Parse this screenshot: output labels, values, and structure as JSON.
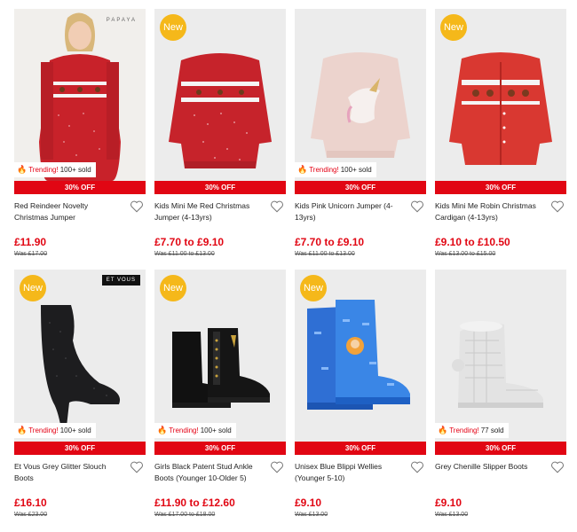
{
  "colors": {
    "accent_red": "#e10613",
    "new_badge": "#f5b81a",
    "card_bg": "#ececec"
  },
  "products": [
    {
      "name": "Red Reindeer Novelty Christmas Jumper",
      "discount": "30% OFF",
      "price": "£11.90",
      "was": "Was £17.00",
      "trending": {
        "label": "Trending!",
        "sold": "100+ sold"
      },
      "brand": "PAPAYA",
      "is_new": false
    },
    {
      "name": "Kids Mini Me Red Christmas Jumper (4-13yrs)",
      "discount": "30% OFF",
      "price": "£7.70 to £9.10",
      "was": "Was £11.00 to £13.00",
      "new_label": "New",
      "is_new": true
    },
    {
      "name": "Kids Pink Unicorn Jumper (4-13yrs)",
      "discount": "30% OFF",
      "price": "£7.70 to £9.10",
      "was": "Was £11.00 to £13.00",
      "trending": {
        "label": "Trending!",
        "sold": "100+ sold"
      },
      "is_new": false
    },
    {
      "name": "Kids Mini Me Robin Christmas Cardigan (4-13yrs)",
      "discount": "30% OFF",
      "price": "£9.10 to £10.50",
      "was": "Was £13.00 to £15.00",
      "new_label": "New",
      "is_new": true
    },
    {
      "name": "Et Vous Grey Glitter Slouch Boots",
      "discount": "30% OFF",
      "price": "£16.10",
      "was": "Was £23.00",
      "trending": {
        "label": "Trending!",
        "sold": "100+ sold"
      },
      "brand": "ET VOUS",
      "new_label": "New",
      "is_new": true
    },
    {
      "name": "Girls Black Patent Stud Ankle Boots (Younger 10-Older 5)",
      "discount": "30% OFF",
      "price": "£11.90 to £12.60",
      "was": "Was £17.00 to £18.00",
      "trending": {
        "label": "Trending!",
        "sold": "100+ sold"
      },
      "new_label": "New",
      "is_new": true
    },
    {
      "name": "Unisex Blue Blippi Wellies (Younger 5-10)",
      "discount": "30% OFF",
      "price": "£9.10",
      "was": "Was £13.00",
      "new_label": "New",
      "is_new": true
    },
    {
      "name": "Grey Chenille Slipper Boots",
      "discount": "30% OFF",
      "price": "£9.10",
      "was": "Was £13.00",
      "trending": {
        "label": "Trending!",
        "sold": "77 sold"
      },
      "is_new": false
    }
  ]
}
